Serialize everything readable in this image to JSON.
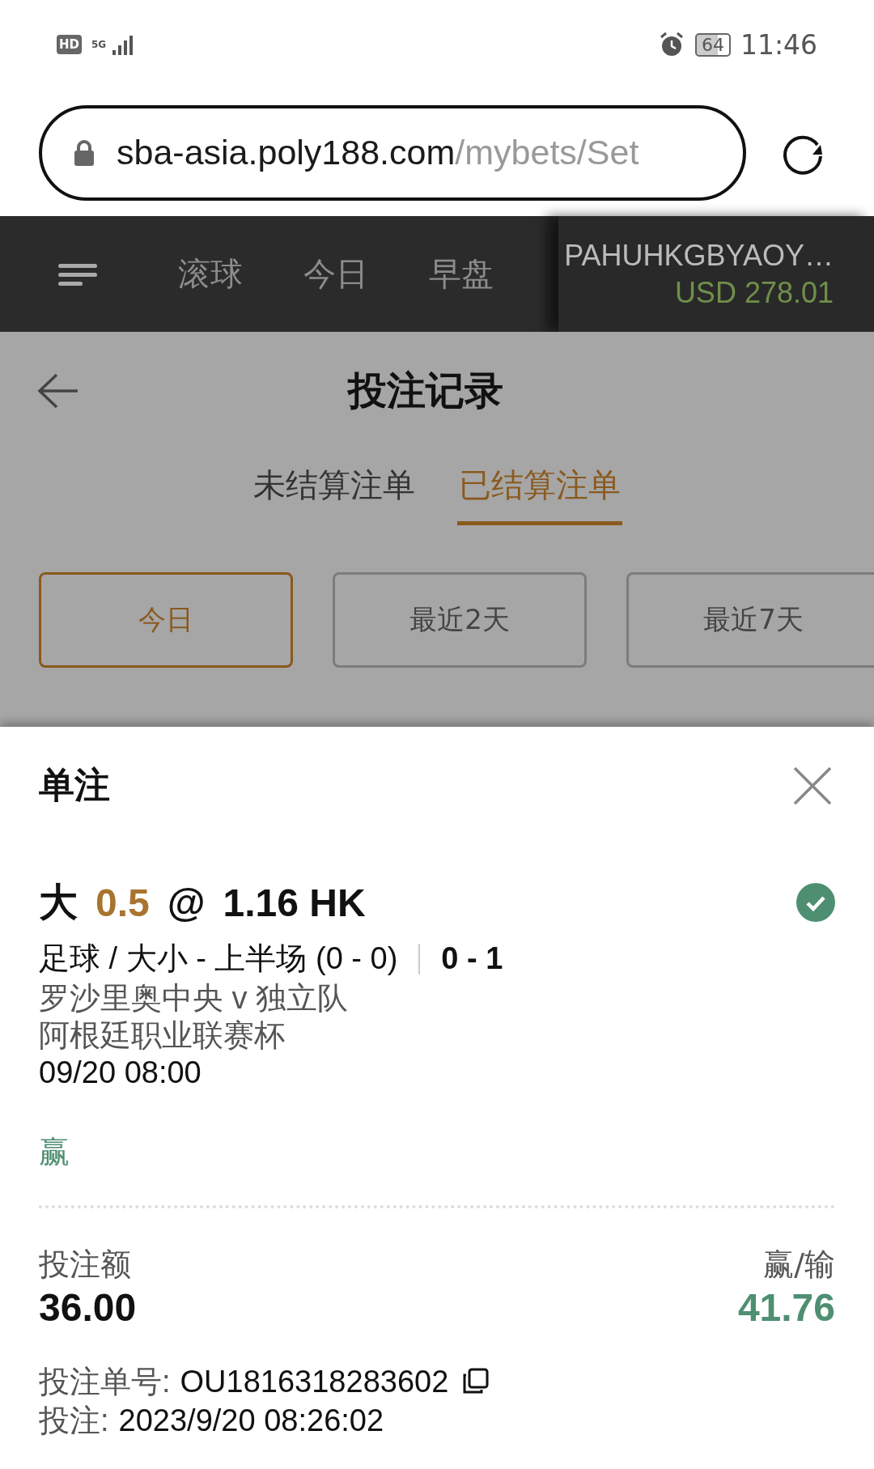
{
  "status_bar": {
    "hd": "HD",
    "time": "11:46",
    "battery": "64",
    "network": "5G"
  },
  "address_bar": {
    "domain": "sba-asia.poly188.com",
    "path": "/mybets/Set"
  },
  "nav": {
    "tabs": [
      {
        "label": "滚球"
      },
      {
        "label": "今日"
      },
      {
        "label": "早盘"
      }
    ],
    "account": {
      "name": "PAHUHKGBYAOY…",
      "balance": "USD 278.01"
    }
  },
  "page": {
    "title": "投注记录",
    "tabs": [
      {
        "label": "未结算注单",
        "selected": false
      },
      {
        "label": "已结算注单",
        "selected": true
      }
    ],
    "filters": [
      {
        "label": "今日",
        "selected": true
      },
      {
        "label": "最近2天",
        "selected": false
      },
      {
        "label": "最近7天",
        "selected": false
      }
    ]
  },
  "sheet": {
    "title": "单注",
    "bet": {
      "pick": "大",
      "line": "0.5",
      "at": "@",
      "odds": "1.16 HK",
      "won": true,
      "market": "足球 / 大小 - 上半场 (0 - 0)",
      "score": "0 - 1",
      "match": "罗沙里奥中央 v 独立队",
      "league": "阿根廷职业联赛杯",
      "kickoff": "09/20 08:00",
      "result": "赢"
    },
    "stake_label": "投注额",
    "stake": "36.00",
    "payout_label": "赢/输",
    "payout": "41.76",
    "ticket_label": "投注单号:",
    "ticket": "OU1816318283602",
    "placed_label": "投注:",
    "placed": "2023/9/20 08:26:02"
  }
}
